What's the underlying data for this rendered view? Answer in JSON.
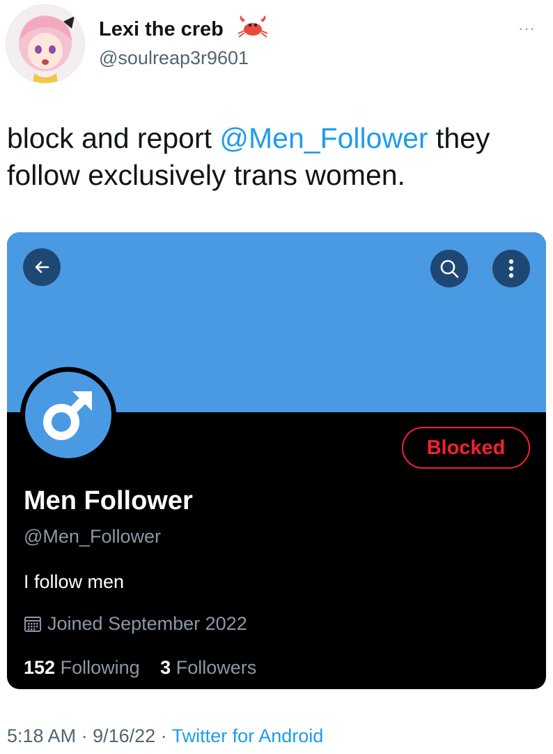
{
  "author": {
    "display_name": "Lexi the creb",
    "handle": "@soulreap3r9601",
    "emoji_icon": "crab-icon",
    "more_icon": "more-dots-icon",
    "more_glyph": "···"
  },
  "tweet": {
    "text_before": "block and report ",
    "mention": "@Men_Follower",
    "text_after": " they follow exclusively trans women."
  },
  "profile_card": {
    "banner_color": "#4a9ae3",
    "background_color": "#000000",
    "back_icon": "arrow-left-icon",
    "search_icon": "search-icon",
    "menu_icon": "vertical-dots-icon",
    "avatar_icon": "male-symbol-icon",
    "blocked_label": "Blocked",
    "name": "Men Follower",
    "handle": "@Men_Follower",
    "bio": "I follow men",
    "calendar_icon": "calendar-icon",
    "joined": "Joined September 2022",
    "following_count": "152",
    "following_label": "Following",
    "followers_count": "3",
    "followers_label": "Followers"
  },
  "footer": {
    "time": "5:18 AM",
    "separator": " · ",
    "date": "9/16/22",
    "source": "Twitter for Android"
  }
}
